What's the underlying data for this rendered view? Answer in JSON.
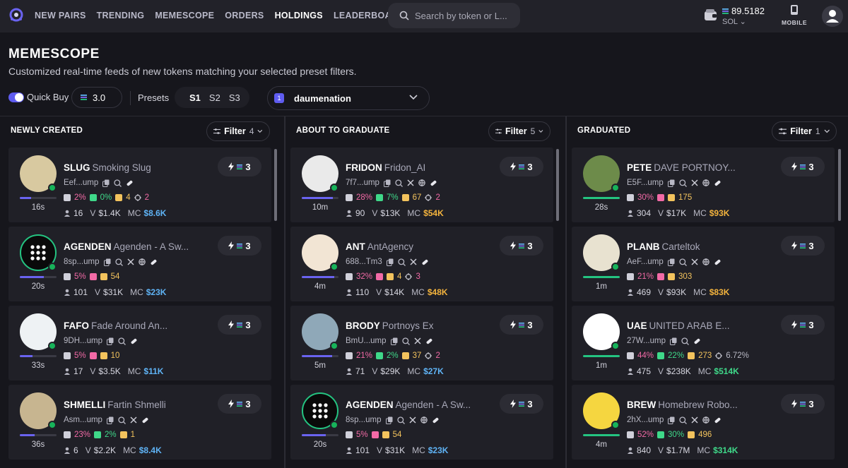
{
  "nav": {
    "links": [
      "NEW PAIRS",
      "TRENDING",
      "MEMESCOPE",
      "ORDERS",
      "HOLDINGS",
      "LEADERBOARD"
    ],
    "active_index": 4,
    "search_placeholder": "Search by token or L...",
    "balance": "89.5182",
    "currency": "SOL",
    "mobile_label": "MOBILE"
  },
  "header": {
    "title": "MEMESCOPE",
    "subtitle": "Customized real-time feeds of new tokens matching your selected preset filters."
  },
  "controls": {
    "quick_buy_label": "Quick Buy",
    "quick_buy_on": true,
    "amount": "3.0",
    "presets_label": "Presets",
    "presets": [
      "S1",
      "S2",
      "S3"
    ],
    "active_preset": "S1",
    "wallet_index": "1",
    "wallet_name": "daumenation"
  },
  "columns": [
    {
      "title": "NEWLY CREATED",
      "filter_label": "Filter",
      "filter_count": "4",
      "cards": [
        {
          "symbol": "SLUG",
          "name": "Smoking Slug",
          "addr": "Eef...ump",
          "age": "16s",
          "progress": 0.3,
          "s1": "2%",
          "s2": "0%",
          "s2_color": "green",
          "s3": "4",
          "s4": "2",
          "holders": "16",
          "vol": "$1.4K",
          "mc": "$8.6K",
          "mc_color": "blue",
          "buy": "3",
          "socials": [
            "pill"
          ],
          "avatar_bg": "#d8c9a0"
        },
        {
          "symbol": "AGENDEN",
          "name": "Agenden - A Sw...",
          "addr": "8sp...ump",
          "age": "20s",
          "progress": 0.65,
          "s1": "5%",
          "s2": "DS",
          "s2_color": "pink",
          "s3": "54",
          "s4": "",
          "holders": "101",
          "vol": "$31K",
          "mc": "$23K",
          "mc_color": "blue",
          "buy": "3",
          "socials": [
            "x",
            "web",
            "pill"
          ],
          "avatar_bg": "#0a0a0a"
        },
        {
          "symbol": "FAFO",
          "name": "Fade Around An...",
          "addr": "9DH...ump",
          "age": "33s",
          "progress": 0.35,
          "s1": "5%",
          "s2": "DS",
          "s2_color": "pink",
          "s3": "10",
          "s4": "",
          "holders": "17",
          "vol": "$3.5K",
          "mc": "$11K",
          "mc_color": "blue",
          "buy": "3",
          "socials": [
            "pill"
          ],
          "avatar_bg": "#eef2f4"
        },
        {
          "symbol": "SHMELLI",
          "name": "Fartin Shmelli",
          "addr": "Asm...ump",
          "age": "36s",
          "progress": 0.4,
          "s1": "23%",
          "s2": "2%",
          "s2_color": "green",
          "s3": "1",
          "s4": "",
          "holders": "6",
          "vol": "$2.2K",
          "mc": "$8.4K",
          "mc_color": "blue",
          "buy": "3",
          "socials": [
            "x",
            "pill"
          ],
          "avatar_bg": "#c7b590"
        }
      ]
    },
    {
      "title": "ABOUT TO GRADUATE",
      "filter_label": "Filter",
      "filter_count": "5",
      "cards": [
        {
          "symbol": "FRIDON",
          "name": "Fridon_AI",
          "addr": "7f7...ump",
          "age": "10m",
          "progress": 0.85,
          "s1": "28%",
          "s2": "7%",
          "s2_color": "green",
          "s3": "67",
          "s4": "2",
          "holders": "90",
          "vol": "$13K",
          "mc": "$54K",
          "mc_color": "orange",
          "buy": "3",
          "socials": [
            "x",
            "web",
            "pill"
          ],
          "avatar_bg": "#eaeaea"
        },
        {
          "symbol": "ANT",
          "name": "AntAgency",
          "addr": "688...Tm3",
          "age": "4m",
          "progress": 0.88,
          "s1": "32%",
          "s2": "DS",
          "s2_color": "pink",
          "s3": "4",
          "s4": "3",
          "holders": "110",
          "vol": "$14K",
          "mc": "$48K",
          "mc_color": "orange",
          "buy": "3",
          "socials": [
            "x",
            "pill"
          ],
          "avatar_bg": "#f2e5d4"
        },
        {
          "symbol": "BRODY",
          "name": "Portnoys Ex",
          "addr": "BmU...ump",
          "age": "5m",
          "progress": 0.82,
          "s1": "21%",
          "s2": "2%",
          "s2_color": "green",
          "s3": "37",
          "s4": "2",
          "holders": "71",
          "vol": "$29K",
          "mc": "$27K",
          "mc_color": "blue",
          "buy": "3",
          "socials": [
            "x",
            "pill"
          ],
          "avatar_bg": "#8fa8b8"
        },
        {
          "symbol": "AGENDEN",
          "name": "Agenden - A Sw...",
          "addr": "8sp...ump",
          "age": "20s",
          "progress": 0.65,
          "s1": "5%",
          "s2": "DS",
          "s2_color": "pink",
          "s3": "54",
          "s4": "",
          "holders": "101",
          "vol": "$31K",
          "mc": "$23K",
          "mc_color": "blue",
          "buy": "3",
          "socials": [
            "x",
            "web",
            "pill"
          ],
          "avatar_bg": "#0a0a0a"
        }
      ]
    },
    {
      "title": "GRADUATED",
      "filter_label": "Filter",
      "filter_count": "1",
      "cards": [
        {
          "symbol": "PETE",
          "name": "DAVE PORTNOY...",
          "addr": "E5F...ump",
          "age": "28s",
          "progress": 1,
          "s1": "30%",
          "s2": "DS",
          "s2_color": "pink",
          "s3": "175",
          "s4": "",
          "holders": "304",
          "vol": "$17K",
          "mc": "$93K",
          "mc_color": "orange",
          "buy": "3",
          "socials": [
            "x",
            "web",
            "pill"
          ],
          "avatar_bg": "#6d8b4a"
        },
        {
          "symbol": "PLANB",
          "name": "Carteltok",
          "addr": "AeF...ump",
          "age": "1m",
          "progress": 1,
          "s1": "21%",
          "s2": "DS",
          "s2_color": "pink",
          "s3": "303",
          "s4": "",
          "holders": "469",
          "vol": "$93K",
          "mc": "$83K",
          "mc_color": "orange",
          "buy": "3",
          "socials": [
            "x",
            "web",
            "pill"
          ],
          "avatar_bg": "#e8e2d0"
        },
        {
          "symbol": "UAE",
          "name": "UNITED ARAB E...",
          "addr": "27W...ump",
          "age": "1m",
          "progress": 1,
          "s1": "44%",
          "s2": "22%",
          "s2_color": "green",
          "s3": "273",
          "s4": "6.72%",
          "holders": "475",
          "vol": "$238K",
          "mc": "$514K",
          "mc_color": "green",
          "buy": "3",
          "socials": [
            "pill"
          ],
          "avatar_bg": "#ffffff"
        },
        {
          "symbol": "BREW",
          "name": "Homebrew Robo...",
          "addr": "2hX...ump",
          "age": "4m",
          "progress": 1,
          "s1": "52%",
          "s2": "30%",
          "s2_color": "green",
          "s3": "496",
          "s4": "",
          "holders": "840",
          "vol": "$1.7M",
          "mc": "$314K",
          "mc_color": "green",
          "buy": "3",
          "socials": [
            "x",
            "web",
            "pill"
          ],
          "avatar_bg": "#f5d640"
        }
      ]
    }
  ],
  "labels": {
    "vol_prefix": "V",
    "mc_prefix": "MC"
  },
  "colors": {
    "accent": "#5f5cf0",
    "green": "#24c481",
    "pink": "#f26aa6",
    "orange": "#f3b33d",
    "blue": "#5fb3f5"
  }
}
